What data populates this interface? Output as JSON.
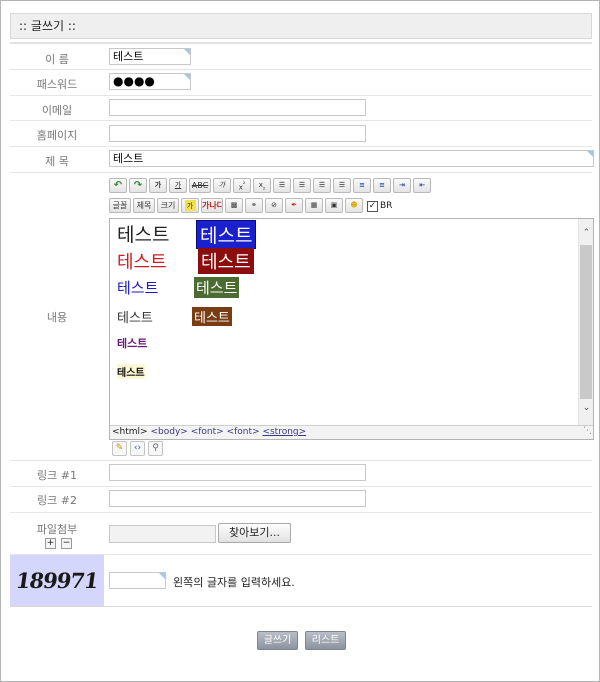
{
  "title": ":: 글쓰기 ::",
  "fields": {
    "name": {
      "label": "이 름",
      "value": "테스트"
    },
    "password": {
      "label": "패스워드",
      "value": "●●●●"
    },
    "email": {
      "label": "이메일",
      "value": ""
    },
    "homepage": {
      "label": "홈페이지",
      "value": ""
    },
    "subject": {
      "label": "제 목",
      "value": "테스트"
    },
    "content": {
      "label": "내용"
    },
    "link1": {
      "label": "링크 #1",
      "value": ""
    },
    "link2": {
      "label": "링크 #2",
      "value": ""
    },
    "attach": {
      "label": "파일첨부",
      "browse": "찾아보기..."
    }
  },
  "editor": {
    "toolbar_row1": [
      "undo-icon",
      "redo-icon",
      "가",
      "가",
      "ABC",
      "가",
      "x²",
      "x₂",
      "align-left",
      "align-center",
      "align-right",
      "justify",
      "ordered-list",
      "unordered-list",
      "indent",
      "outdent"
    ],
    "toolbar_row2_labels": {
      "font": "글꼴",
      "heading": "제목",
      "size": "크기",
      "bg": "가",
      "color": "가나다"
    },
    "br_label": "BR",
    "br_checked": true,
    "samples": [
      {
        "text": "테스트",
        "color": "#000000",
        "size": 19
      },
      {
        "text": "테스트",
        "color": "#ffffff",
        "bg": "#1a20cc",
        "size": 19
      },
      {
        "text": "테스트",
        "color": "#cc2020",
        "size": 18
      },
      {
        "text": "테스트",
        "color": "#ffffff",
        "bg": "#8b0d0d",
        "size": 18
      },
      {
        "text": "테스트",
        "color": "#1a1abf",
        "size": 15
      },
      {
        "text": "테스트",
        "color": "#ffffff",
        "bg": "#4b6b32",
        "size": 15
      },
      {
        "text": "테스트",
        "color": "#333333",
        "size": 13
      },
      {
        "text": "테스트",
        "color": "#ffffff",
        "bg": "#7a3c12",
        "size": 13
      },
      {
        "text": "테스트",
        "color": "#6d1b7a",
        "size": 11
      },
      {
        "text": "테스트",
        "color": "#111111",
        "bg": "#fbf8d4",
        "size": 10
      }
    ],
    "path": [
      "<html>",
      "<body>",
      "<font>",
      "<font>",
      "<strong>"
    ]
  },
  "captcha": {
    "code": "189971",
    "hint": "왼쪽의 글자를 입력하세요.",
    "value": ""
  },
  "buttons": {
    "submit": "글쓰기",
    "list": "리스트"
  }
}
